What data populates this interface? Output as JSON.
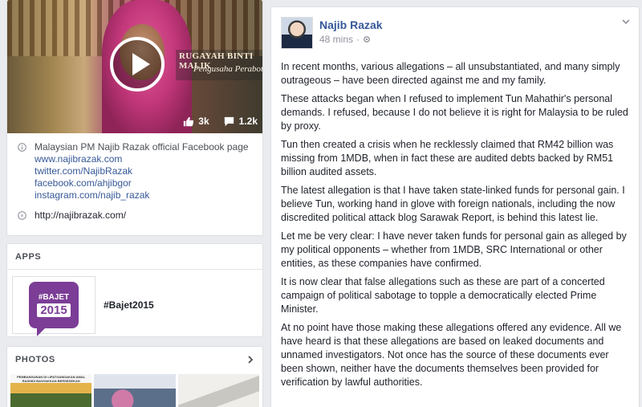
{
  "video": {
    "overlay_name": "RUGAYAH BINTI MALIK",
    "overlay_role": "Pengusaha Perabot",
    "likes": "3k",
    "comments": "1.2k"
  },
  "about": {
    "description": "Malaysian PM Najib Razak official Facebook page",
    "links": [
      "www.najibrazak.com",
      "twitter.com/NajibRazak",
      "facebook.com/ahjibgor",
      "instagram.com/najib_razak"
    ],
    "website": "http://najibrazak.com/"
  },
  "apps": {
    "title": "APPS",
    "item_label": "#Bajet2015",
    "logo_top": "#BAJET",
    "logo_year": "2015"
  },
  "photos": {
    "title": "PHOTOS",
    "thumb_a_caption": "PEMBANGUNAN DI LIPATGANDAKAN AMAL RASHIDI BANYAKKAN BERSEDEKAH"
  },
  "post": {
    "author": "Najib Razak",
    "time": "48 mins",
    "separator": "·",
    "paragraphs": [
      "In recent months, various allegations – all unsubstantiated, and many simply outrageous – have been directed against me and my family.",
      "These attacks began when I refused to implement Tun Mahathir's personal demands. I refused, because I do not believe it is right for Malaysia to be ruled by proxy.",
      "Tun then created a crisis when he recklessly claimed that RM42 billion was missing from 1MDB, when in fact these are audited debts backed by RM51 billion audited assets.",
      "The latest allegation is that I have taken state-linked funds for personal gain. I believe Tun, working hand in glove with foreign nationals, including the now discredited political attack blog Sarawak Report, is behind this latest lie.",
      "Let me be very clear: I have never taken funds for personal gain as alleged by my political opponents – whether from 1MDB, SRC International or other entities, as these companies have confirmed.",
      "It is now clear that false allegations such as these are part of a concerted campaign of political sabotage to topple a democratically elected Prime Minister.",
      "At no point have those making these allegations offered any evidence. All we have heard is that these allegations are based on leaked documents and unnamed investigators. Not once has the source of these documents ever been shown, neither have the documents themselves been provided for verification by lawful authorities."
    ]
  },
  "colors": {
    "link": "#365899",
    "page_bg": "#e9ebee",
    "meta": "#90949c",
    "bajet_purple": "#7b3d96"
  },
  "icons": [
    "play-icon",
    "like-icon",
    "comment-icon",
    "info-icon",
    "globe-icon",
    "chevron-right-icon",
    "caret-down-icon",
    "public-icon"
  ]
}
